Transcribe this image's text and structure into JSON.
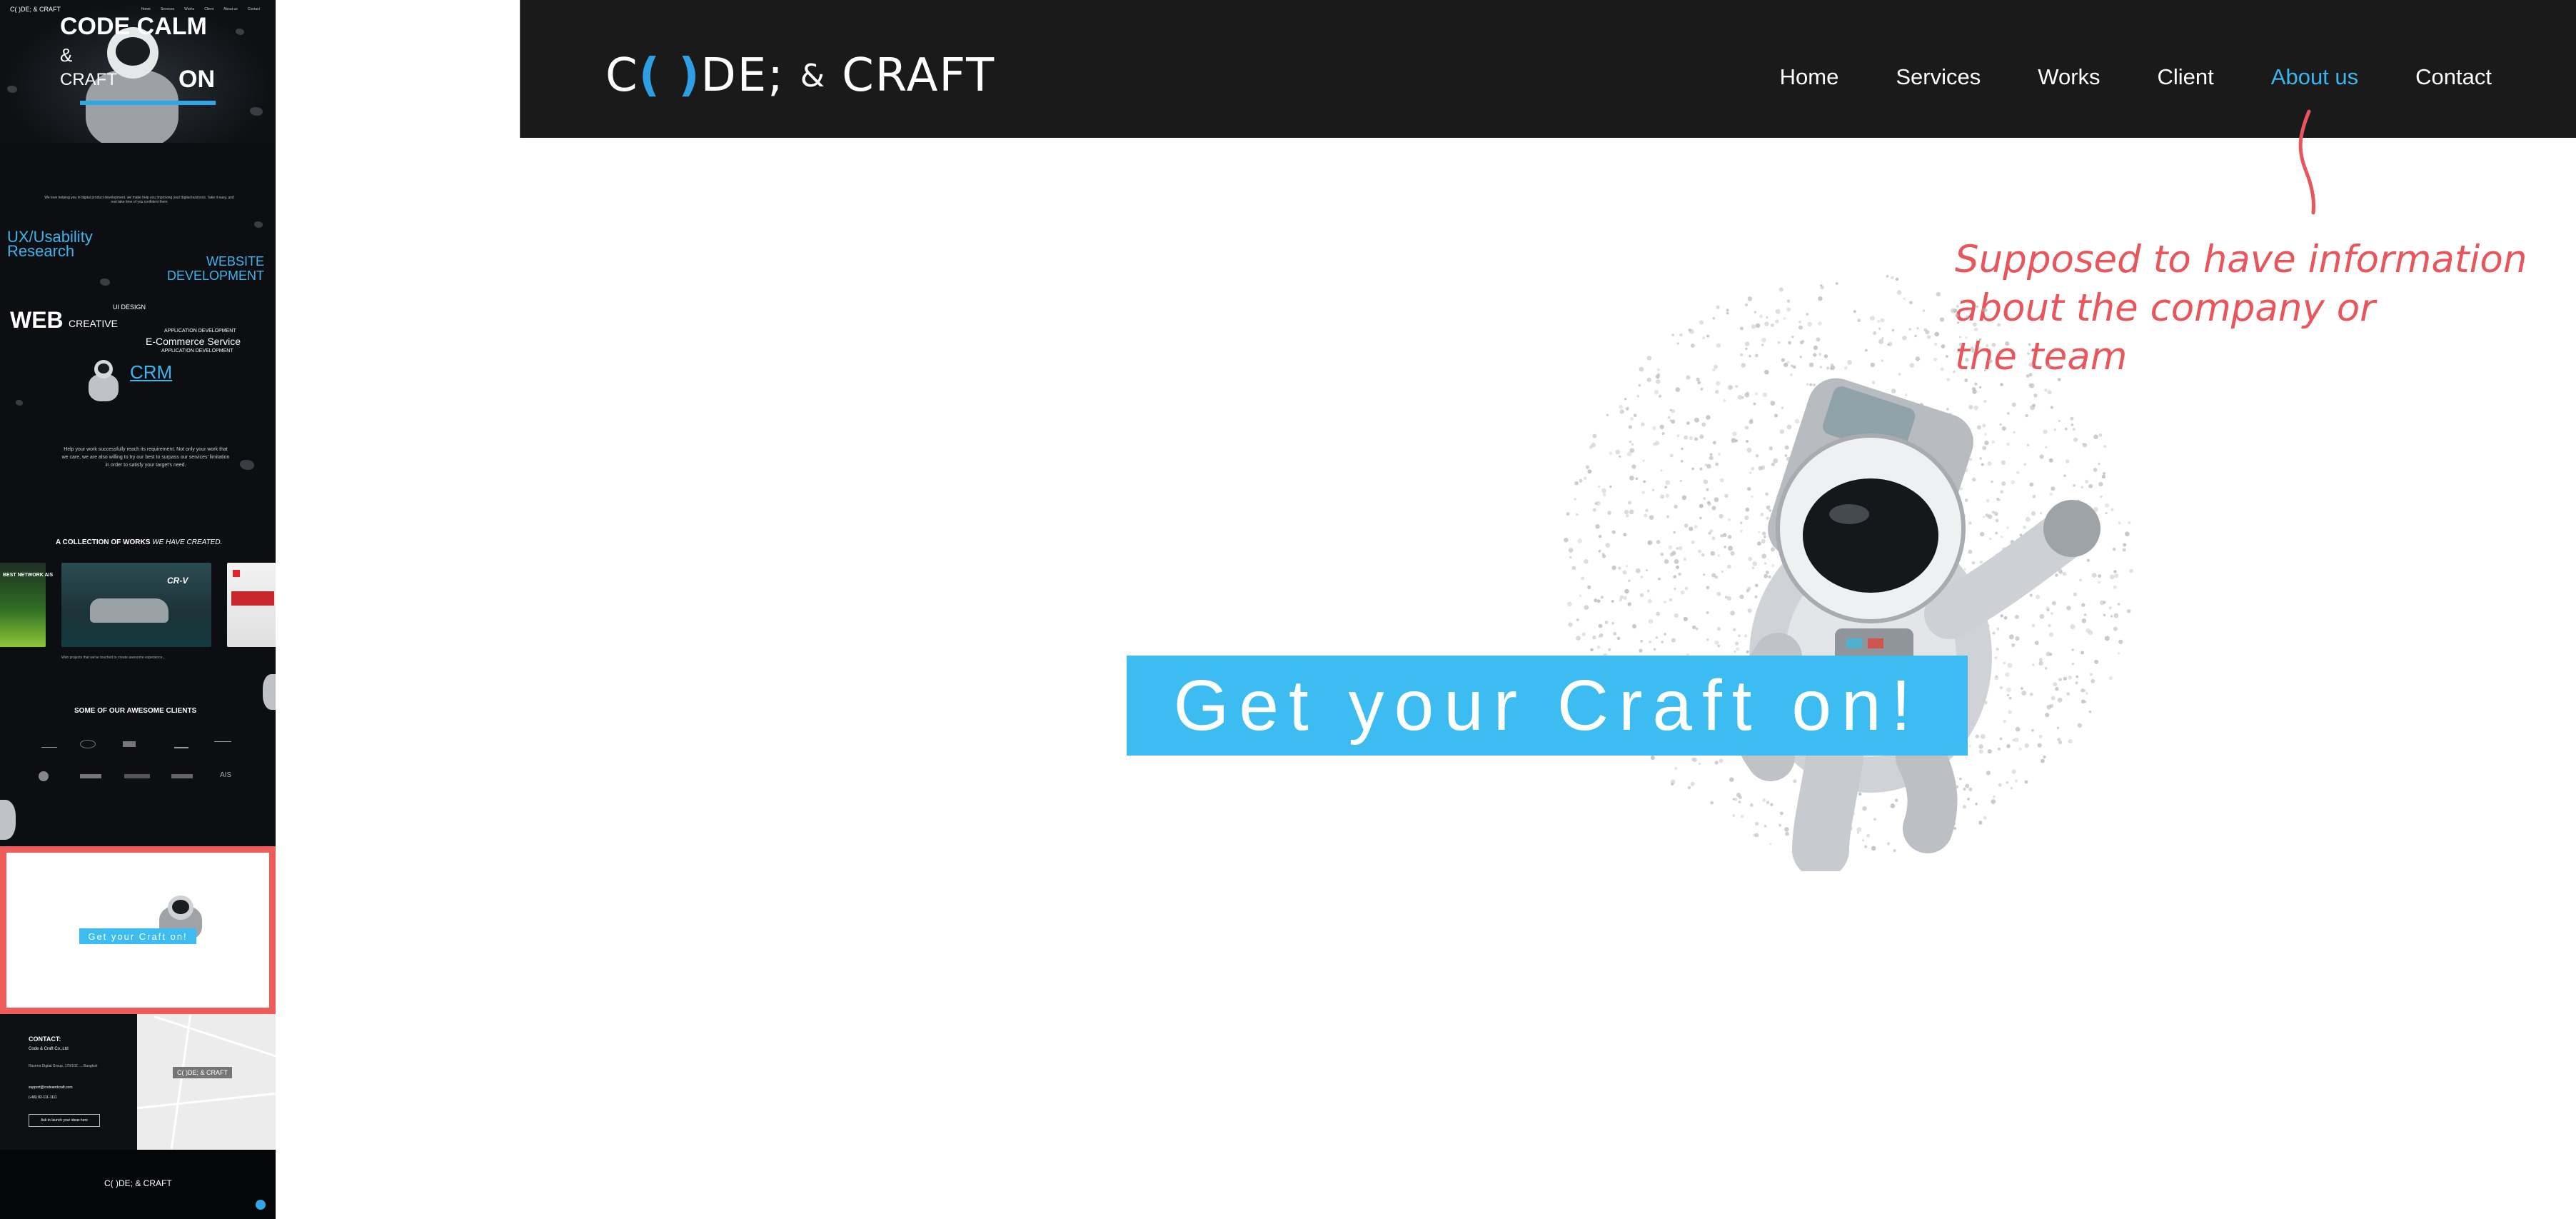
{
  "thumbnail_strip": {
    "hero": {
      "brand": "C( )DE; & CRAFT",
      "headline": "CODE CALM",
      "amp": "&",
      "craft": "CRAFT",
      "on": "ON",
      "nav": [
        "Home",
        "Services",
        "Works",
        "Client",
        "About us",
        "Contact"
      ]
    },
    "services": {
      "intro": "We love helping you in digital product development. we make help you improving your digital business. Take it easy, and rest take time of you confident them",
      "items": [
        "UX/Usability Research",
        "WEBSITE DEVELOPMENT",
        "UI DESIGN",
        "WEB",
        "CREATIVE",
        "APPLICATION DEVELOPMENT",
        "E-Commerce Service",
        "APPLICATION DEVELOPMENT",
        "CRM"
      ],
      "outro": "Help your work successfully reach its requirement. Not only your work that we care, we are also willing to try our best to surpass our services' limitation in order to satisfy your target's need."
    },
    "works": {
      "title": "A COLLECTION OF WORKS",
      "title_italic": "WE HAVE CREATED.",
      "cards": [
        "BEST NETWORK AIS",
        "CR-V",
        ""
      ],
      "caption": "Web projects that we've touched to create awesome experience..."
    },
    "clients": {
      "title": "SOME OF OUR AWESOME CLIENTS",
      "logos": [
        "",
        "",
        "",
        "",
        "",
        "",
        "",
        "",
        "",
        "AIS"
      ]
    },
    "about": {
      "cta": "Get your Craft on!"
    },
    "contact": {
      "title": "CONTACT:",
      "company": "Code & Craft Co.,Ltd",
      "address": "Rasena Digital Group, 179/102 ..., Bangkok",
      "email": "support@codeandcraft.com",
      "phone": "(+66) 82-111-1111",
      "button": "Ask to launch your ideas here",
      "map_label": "C( )DE; & CRAFT"
    },
    "footer": {
      "brand": "C( )DE; & CRAFT"
    }
  },
  "navbar": {
    "logo": {
      "part1": "C",
      "paren": "( )",
      "part2": "DE;",
      "amp": "&",
      "craft": "CRAFT"
    },
    "items": [
      {
        "label": "Home",
        "active": false
      },
      {
        "label": "Services",
        "active": false
      },
      {
        "label": "Works",
        "active": false
      },
      {
        "label": "Client",
        "active": false
      },
      {
        "label": "About us",
        "active": true
      },
      {
        "label": "Contact",
        "active": false
      }
    ]
  },
  "annotation": {
    "lines": [
      "Supposed to have information",
      "about the company or",
      "the team"
    ],
    "color": "#e8555a"
  },
  "about": {
    "cta": "Get your Craft on!",
    "accent": "#3dbcf2"
  },
  "colors": {
    "nav_bg": "#1a1a1a",
    "accent_blue": "#3ab6ee",
    "highlight_red": "#ef5a5a"
  }
}
